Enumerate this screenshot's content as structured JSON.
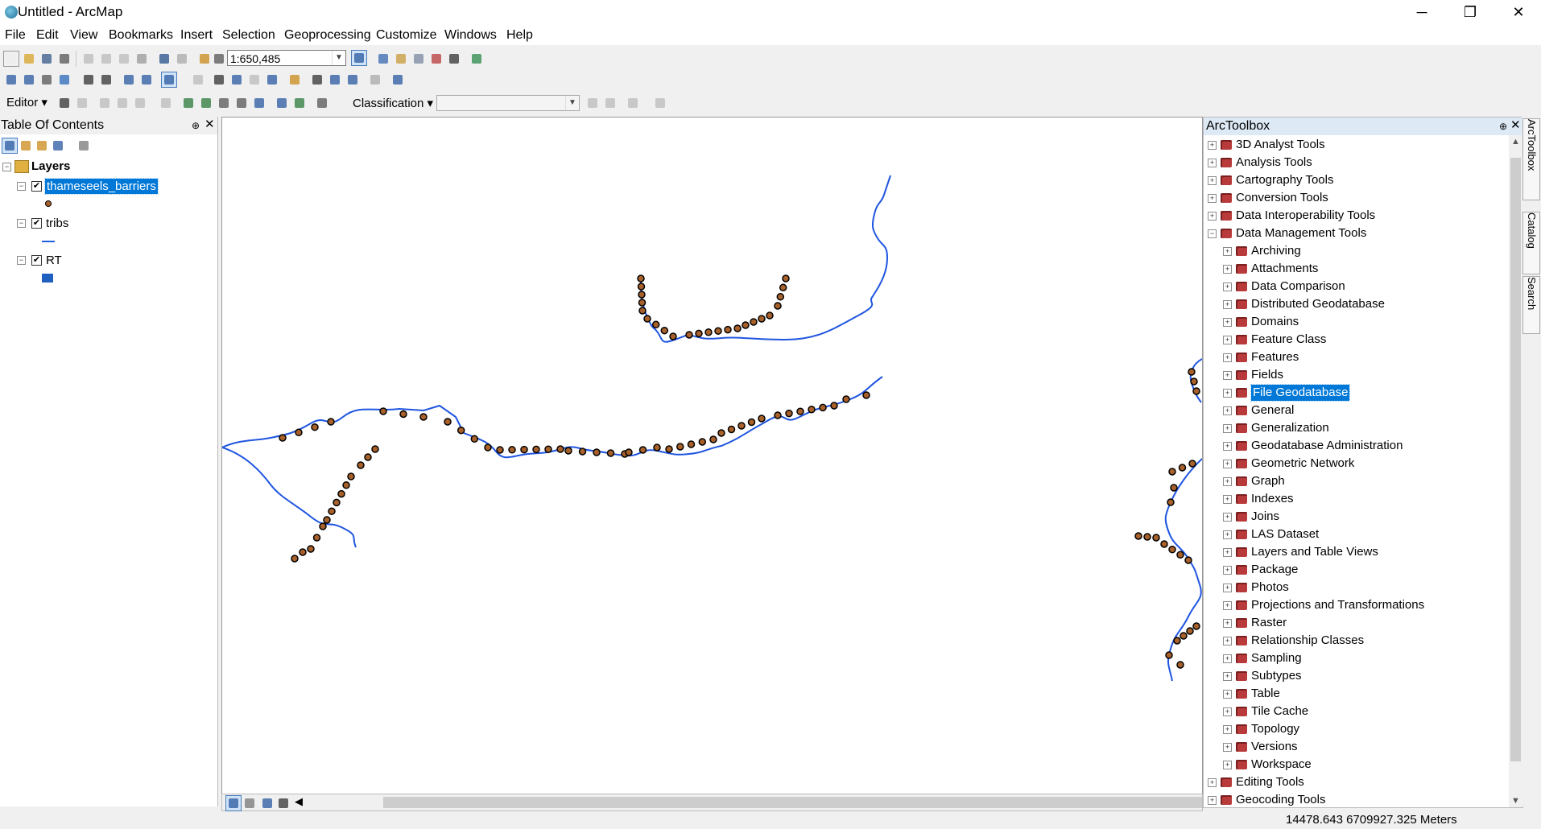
{
  "window": {
    "title": "Untitled - ArcMap",
    "minimize_label": "─",
    "maximize_label": "❐",
    "close_label": "✕"
  },
  "menu": [
    "File",
    "Edit",
    "View",
    "Bookmarks",
    "Insert",
    "Selection",
    "Geoprocessing",
    "Customize",
    "Windows",
    "Help"
  ],
  "toolbar": {
    "scale_value": "1:650,485",
    "editor_label": "Editor ▾",
    "classification_label": "Classification ▾",
    "classification_value": ""
  },
  "toc": {
    "title": "Table Of Contents",
    "pin": "⊕",
    "close": "✕",
    "root": "Layers",
    "layers": [
      {
        "name": "thameseels_barriers",
        "checked": "✔"
      },
      {
        "name": "tribs",
        "checked": "✔"
      },
      {
        "name": "RT",
        "checked": "✔"
      }
    ],
    "colors": {
      "barrier_fill": "#a8612a",
      "stream": "#1f5fe0",
      "rt": "#1f5fc0"
    }
  },
  "map": {
    "colors": {
      "river": "#1f55e0",
      "barrier": "#a8612a"
    }
  },
  "toolbox": {
    "title": "ArcToolbox",
    "pin": "⊕",
    "close": "✕",
    "items": [
      {
        "label": "3D Analyst Tools",
        "level": 0,
        "expanded": false
      },
      {
        "label": "Analysis Tools",
        "level": 0,
        "expanded": false
      },
      {
        "label": "Cartography Tools",
        "level": 0,
        "expanded": false
      },
      {
        "label": "Conversion Tools",
        "level": 0,
        "expanded": false
      },
      {
        "label": "Data Interoperability Tools",
        "level": 0,
        "expanded": false
      },
      {
        "label": "Data Management Tools",
        "level": 0,
        "expanded": true
      },
      {
        "label": "Archiving",
        "level": 1,
        "expanded": false
      },
      {
        "label": "Attachments",
        "level": 1,
        "expanded": false
      },
      {
        "label": "Data Comparison",
        "level": 1,
        "expanded": false
      },
      {
        "label": "Distributed Geodatabase",
        "level": 1,
        "expanded": false
      },
      {
        "label": "Domains",
        "level": 1,
        "expanded": false
      },
      {
        "label": "Feature Class",
        "level": 1,
        "expanded": false
      },
      {
        "label": "Features",
        "level": 1,
        "expanded": false
      },
      {
        "label": "Fields",
        "level": 1,
        "expanded": false
      },
      {
        "label": "File Geodatabase",
        "level": 1,
        "expanded": false,
        "selected": true
      },
      {
        "label": "General",
        "level": 1,
        "expanded": false
      },
      {
        "label": "Generalization",
        "level": 1,
        "expanded": false
      },
      {
        "label": "Geodatabase Administration",
        "level": 1,
        "expanded": false
      },
      {
        "label": "Geometric Network",
        "level": 1,
        "expanded": false
      },
      {
        "label": "Graph",
        "level": 1,
        "expanded": false
      },
      {
        "label": "Indexes",
        "level": 1,
        "expanded": false
      },
      {
        "label": "Joins",
        "level": 1,
        "expanded": false
      },
      {
        "label": "LAS Dataset",
        "level": 1,
        "expanded": false
      },
      {
        "label": "Layers and Table Views",
        "level": 1,
        "expanded": false
      },
      {
        "label": "Package",
        "level": 1,
        "expanded": false
      },
      {
        "label": "Photos",
        "level": 1,
        "expanded": false
      },
      {
        "label": "Projections and Transformations",
        "level": 1,
        "expanded": false
      },
      {
        "label": "Raster",
        "level": 1,
        "expanded": false
      },
      {
        "label": "Relationship Classes",
        "level": 1,
        "expanded": false
      },
      {
        "label": "Sampling",
        "level": 1,
        "expanded": false
      },
      {
        "label": "Subtypes",
        "level": 1,
        "expanded": false
      },
      {
        "label": "Table",
        "level": 1,
        "expanded": false
      },
      {
        "label": "Tile Cache",
        "level": 1,
        "expanded": false
      },
      {
        "label": "Topology",
        "level": 1,
        "expanded": false
      },
      {
        "label": "Versions",
        "level": 1,
        "expanded": false
      },
      {
        "label": "Workspace",
        "level": 1,
        "expanded": false
      },
      {
        "label": "Editing Tools",
        "level": 0,
        "expanded": false
      },
      {
        "label": "Geocoding Tools",
        "level": 0,
        "expanded": false
      }
    ]
  },
  "side_tabs": [
    "ArcToolbox",
    "Catalog",
    "Search"
  ],
  "status": {
    "coordinates": "14478.643  6709927.325 Meters"
  }
}
